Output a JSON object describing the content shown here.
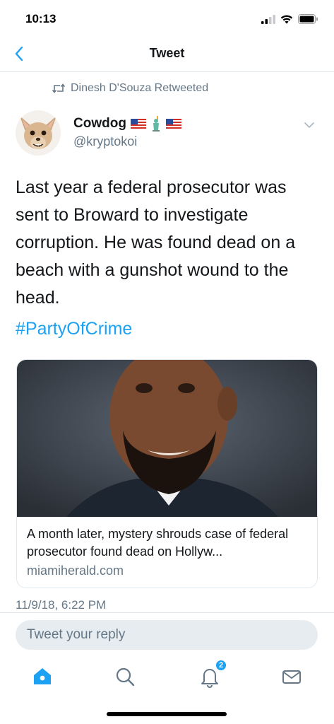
{
  "status_bar": {
    "time": "10:13",
    "icons": [
      "cellular-signal-icon",
      "wifi-icon",
      "battery-icon"
    ]
  },
  "nav": {
    "back_icon": "chevron-left-icon",
    "title": "Tweet"
  },
  "retweet": {
    "icon": "retweet-icon",
    "text": "Dinesh D'Souza Retweeted"
  },
  "author": {
    "name": "Cowdog",
    "handle": "@kryptokoi",
    "name_emojis": [
      "us-flag-icon",
      "statue-of-liberty-icon",
      "us-flag-icon"
    ],
    "avatar": "chihuahua-avatar",
    "menu_icon": "chevron-down-icon"
  },
  "tweet": {
    "text": "Last year a federal prosecutor was\nsent to Broward to investigate\ncorruption.  He was found dead on a\nbeach with a gunshot wound to the\nhead.",
    "hashtag": "#PartyOfCrime",
    "timestamp": "11/9/18, 6:22 PM"
  },
  "card": {
    "image": "man-portrait-photo",
    "title": "A month later, mystery shrouds case of federal prosecutor found dead on Hollyw...",
    "domain": "miamiherald.com"
  },
  "reply": {
    "placeholder": "Tweet your reply"
  },
  "tab_bar": {
    "tabs": [
      {
        "icon": "home-icon",
        "active": true
      },
      {
        "icon": "search-icon",
        "active": false
      },
      {
        "icon": "notifications-bell-icon",
        "active": false,
        "badge": "2"
      },
      {
        "icon": "messages-envelope-icon",
        "active": false
      }
    ]
  },
  "colors": {
    "accent": "#1da1f2",
    "text_primary": "#14171a",
    "text_secondary": "#657786",
    "border": "#e1e8ed",
    "input_bg": "#e6ecf0"
  }
}
